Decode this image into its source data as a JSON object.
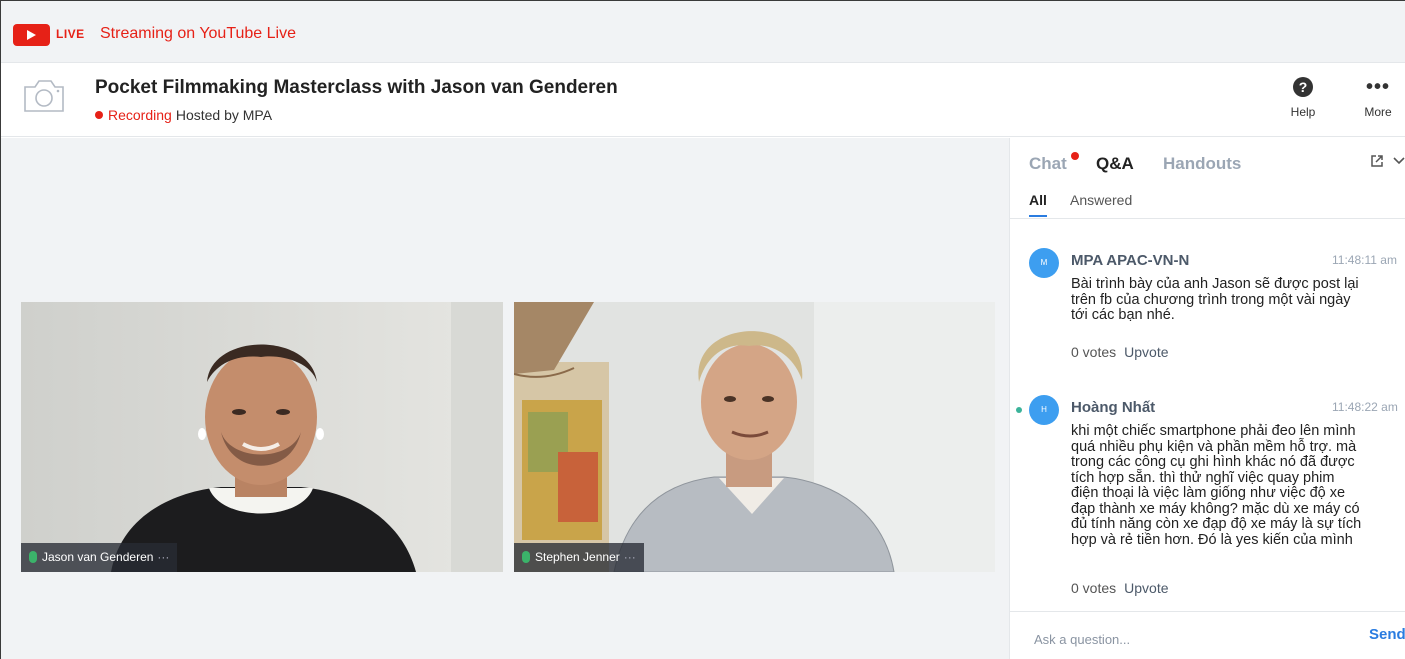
{
  "live_bar": {
    "badge": "LIVE",
    "stream_text": "Streaming on YouTube Live",
    "colors": {
      "accent": "#e62117"
    }
  },
  "header": {
    "title": "Pocket Filmmaking Masterclass with Jason van Genderen",
    "recording_label": "Recording",
    "hosted_text": "Hosted by MPA",
    "help_label": "Help",
    "help_icon": "?",
    "more_label": "More",
    "more_icon": "•••"
  },
  "videos": [
    {
      "name": "Jason van Genderen",
      "more": "···"
    },
    {
      "name": "Stephen Jenner",
      "more": "···"
    }
  ],
  "panel": {
    "tabs": [
      {
        "label": "Chat",
        "has_notification": true
      },
      {
        "label": "Q&A",
        "active": true
      },
      {
        "label": "Handouts"
      }
    ],
    "subtabs": [
      {
        "label": "All",
        "active": true
      },
      {
        "label": "Answered"
      }
    ],
    "messages": [
      {
        "avatar_initial": "M",
        "name": "MPA APAC-VN-N",
        "time": "11:48:11 am",
        "lines": [
          "Bài trình bày của anh Jason sẽ được post lại",
          "trên fb của chương trình trong một vài ngày",
          "tới các bạn nhé."
        ],
        "votes": "0 votes",
        "upvote": "Upvote"
      },
      {
        "avatar_initial": "H",
        "name": "Hoàng Nhất",
        "time": "11:48:22 am",
        "lines": [
          "khi một chiếc smartphone phải đeo lên mình",
          "quá nhiều phụ kiện và phần mềm hỗ trợ. mà",
          "trong các công cụ ghi hình khác nó đã được",
          "tích hợp sẵn. thì thử nghĩ việc quay phim",
          "điện thoại là việc làm giống như việc độ xe",
          "đạp thành xe máy không? mặc dù xe máy có",
          "đủ tính năng còn xe đạp độ xe máy là sự tích",
          "hợp và rẻ tiền hơn. Đó là yes kiến của mình"
        ],
        "votes": "0 votes",
        "upvote": "Upvote"
      }
    ],
    "ask_placeholder": "Ask a question...",
    "send_label": "Send"
  }
}
